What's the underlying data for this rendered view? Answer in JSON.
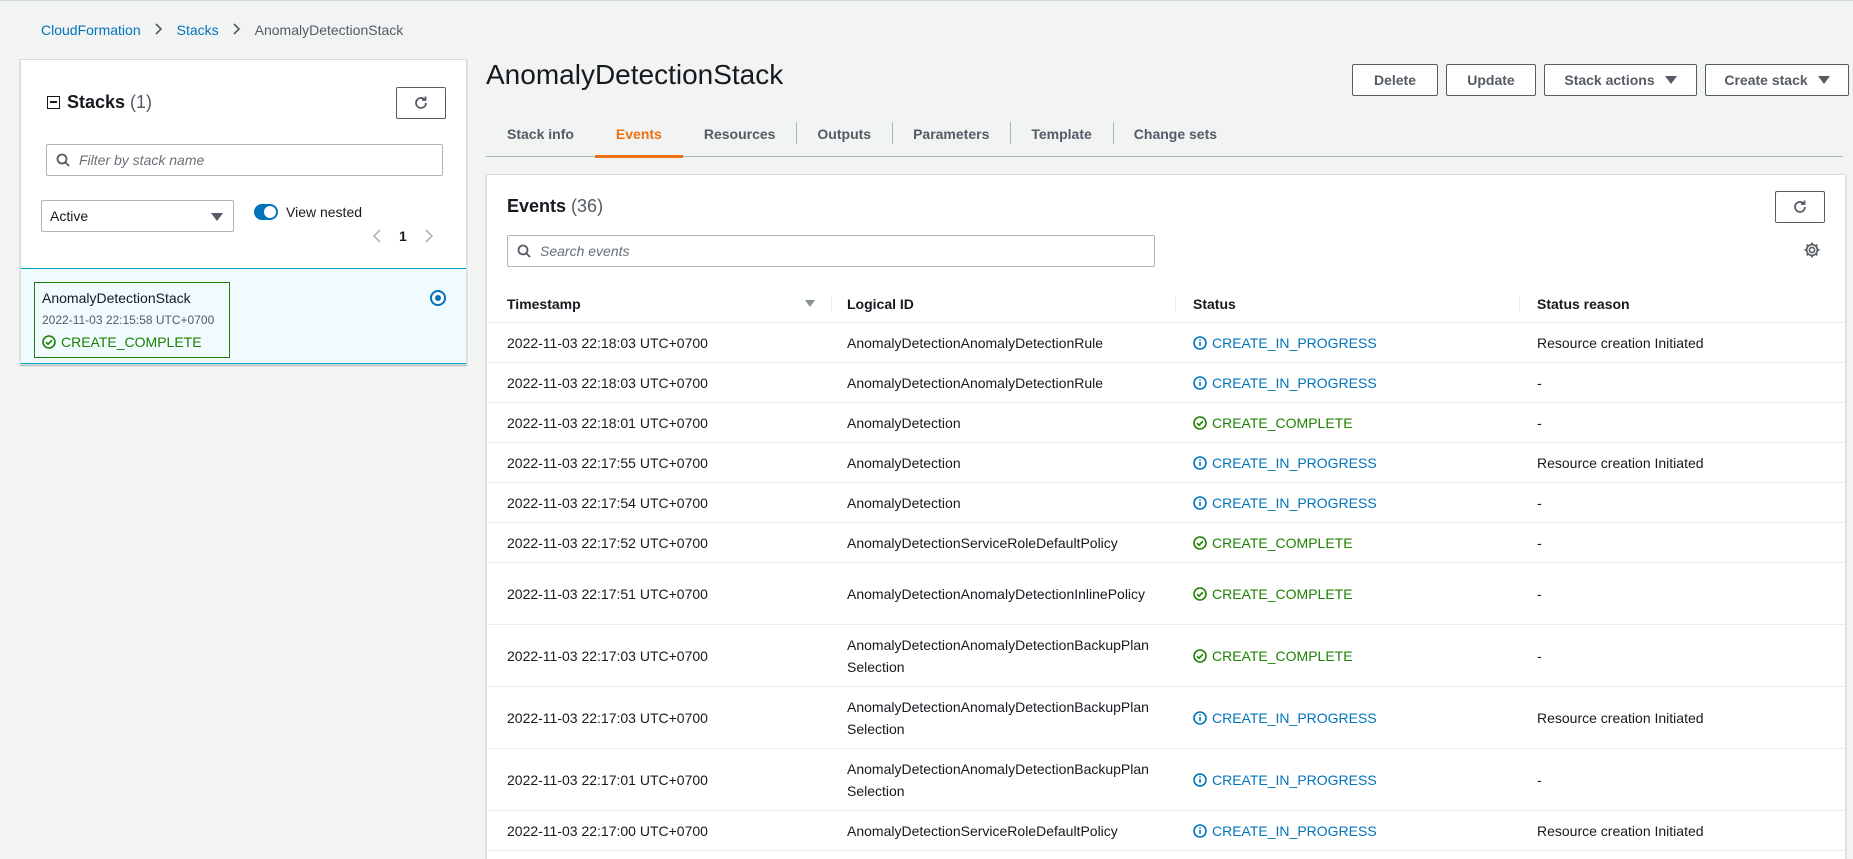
{
  "breadcrumb": {
    "root": "CloudFormation",
    "section": "Stacks",
    "current": "AnomalyDetectionStack"
  },
  "left_panel": {
    "title": "Stacks",
    "count": "(1)",
    "filter_placeholder": "Filter by stack name",
    "status_filter": "Active",
    "view_nested_label": "View nested",
    "view_nested_on": true,
    "page": "1",
    "stack": {
      "name": "AnomalyDetectionStack",
      "date": "2022-11-03 22:15:58 UTC+0700",
      "status": "CREATE_COMPLETE",
      "selected": true
    }
  },
  "main": {
    "title": "AnomalyDetectionStack",
    "buttons": {
      "delete": "Delete",
      "update": "Update",
      "stack_actions": "Stack actions",
      "create_stack": "Create stack"
    },
    "tabs": [
      "Stack info",
      "Events",
      "Resources",
      "Outputs",
      "Parameters",
      "Template",
      "Change sets"
    ],
    "active_tab": "Events"
  },
  "events": {
    "title": "Events",
    "count": "(36)",
    "search_placeholder": "Search events",
    "columns": [
      "Timestamp",
      "Logical ID",
      "Status",
      "Status reason"
    ],
    "rows": [
      {
        "timestamp": "2022-11-03 22:18:03 UTC+0700",
        "logical_id": "AnomalyDetectionAnomalyDetectionRule",
        "status": "CREATE_IN_PROGRESS",
        "reason": "Resource creation Initiated"
      },
      {
        "timestamp": "2022-11-03 22:18:03 UTC+0700",
        "logical_id": "AnomalyDetectionAnomalyDetectionRule",
        "status": "CREATE_IN_PROGRESS",
        "reason": "-"
      },
      {
        "timestamp": "2022-11-03 22:18:01 UTC+0700",
        "logical_id": "AnomalyDetection",
        "status": "CREATE_COMPLETE",
        "reason": "-"
      },
      {
        "timestamp": "2022-11-03 22:17:55 UTC+0700",
        "logical_id": "AnomalyDetection",
        "status": "CREATE_IN_PROGRESS",
        "reason": "Resource creation Initiated"
      },
      {
        "timestamp": "2022-11-03 22:17:54 UTC+0700",
        "logical_id": "AnomalyDetection",
        "status": "CREATE_IN_PROGRESS",
        "reason": "-"
      },
      {
        "timestamp": "2022-11-03 22:17:52 UTC+0700",
        "logical_id": "AnomalyDetectionServiceRoleDefaultPolicy",
        "status": "CREATE_COMPLETE",
        "reason": "-"
      },
      {
        "timestamp": "2022-11-03 22:17:51 UTC+0700",
        "logical_id": "AnomalyDetectionAnomalyDetectionInlinePolicy",
        "status": "CREATE_COMPLETE",
        "reason": "-"
      },
      {
        "timestamp": "2022-11-03 22:17:03 UTC+0700",
        "logical_id": "AnomalyDetectionAnomalyDetectionBackupPlanSelection",
        "status": "CREATE_COMPLETE",
        "reason": "-"
      },
      {
        "timestamp": "2022-11-03 22:17:03 UTC+0700",
        "logical_id": "AnomalyDetectionAnomalyDetectionBackupPlanSelection",
        "status": "CREATE_IN_PROGRESS",
        "reason": "Resource creation Initiated"
      },
      {
        "timestamp": "2022-11-03 22:17:01 UTC+0700",
        "logical_id": "AnomalyDetectionAnomalyDetectionBackupPlanSelection",
        "status": "CREATE_IN_PROGRESS",
        "reason": "-"
      },
      {
        "timestamp": "2022-11-03 22:17:00 UTC+0700",
        "logical_id": "AnomalyDetectionServiceRoleDefaultPolicy",
        "status": "CREATE_IN_PROGRESS",
        "reason": "Resource creation Initiated"
      }
    ]
  },
  "colors": {
    "link": "#0073bb",
    "success": "#1d8102",
    "active_tab": "#ec7211",
    "selected_bg": "#f1faff"
  }
}
